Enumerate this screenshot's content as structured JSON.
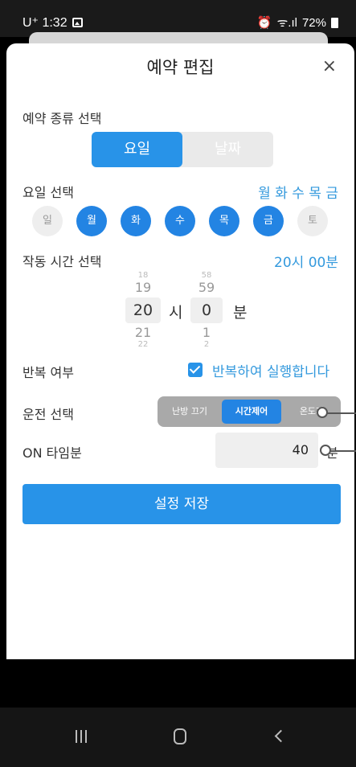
{
  "status": {
    "carrier_time": "U⁺ 1:32",
    "right": "72%"
  },
  "modal": {
    "title": "예약 편집",
    "close": "×"
  },
  "reservation_type": {
    "label": "예약 종류 선택",
    "options": [
      "요일",
      "날짜"
    ],
    "selected": "요일"
  },
  "day_select": {
    "label": "요일 선택",
    "summary": "월 화 수 목 금",
    "days": [
      {
        "name": "일",
        "on": false
      },
      {
        "name": "월",
        "on": true
      },
      {
        "name": "화",
        "on": true
      },
      {
        "name": "수",
        "on": true
      },
      {
        "name": "목",
        "on": true
      },
      {
        "name": "금",
        "on": true
      },
      {
        "name": "토",
        "on": false
      }
    ]
  },
  "time_select": {
    "label": "작동 시간 선택",
    "summary": "20시 00분",
    "hour": {
      "above2": "18",
      "above": "19",
      "value": "20",
      "below": "21",
      "below2": "22"
    },
    "minute": {
      "above2": "58",
      "above": "59",
      "value": "0",
      "below": "1",
      "below2": "2"
    },
    "hour_unit": "시",
    "minute_unit": "분"
  },
  "repeat": {
    "label": "반복 여부",
    "checked": true,
    "text": "반복하여 실행합니다"
  },
  "operation": {
    "label": "운전 선택",
    "options": [
      "난방 끄기",
      "시간제어",
      "온도제"
    ],
    "selected": "시간제어"
  },
  "on_time": {
    "label": "ON 타임분",
    "value": "40",
    "unit": "분"
  },
  "save_button": "설정 저장",
  "colors": {
    "accent": "#2893e8",
    "accent_text": "#3399dd",
    "inactive_day": "#eeeeee",
    "segment_bg": "#a9a9a9"
  }
}
